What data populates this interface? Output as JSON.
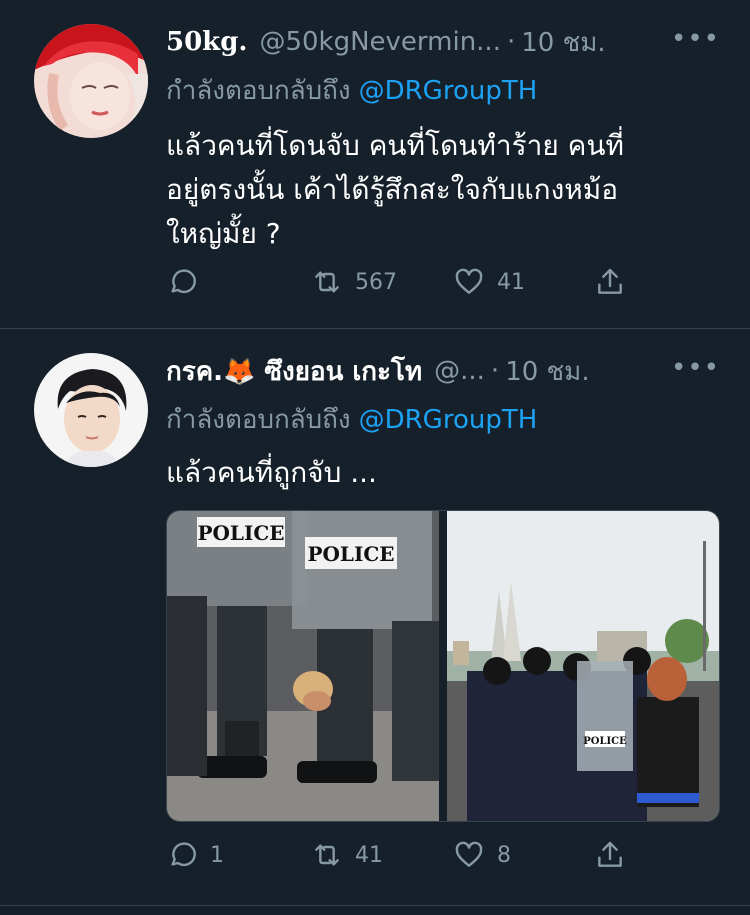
{
  "tweets": [
    {
      "display_name": "50kg.",
      "handle": "@50kgNevermin...",
      "time": "10 ชม.",
      "separator": "·",
      "more": "•••",
      "replying_prefix": "กำลังตอบกลับถึง",
      "replying_to": "@DRGroupTH",
      "text_lines": [
        "แล้วคนที่โดนจับ คนที่โดนทำร้าย คนที่",
        "อยู่ตรงนั้น เค้าได้รู้สึกสะใจกับแกงหม้อ",
        "ใหญ่มั้ย ?"
      ],
      "reply_count": "",
      "retweet_count": "567",
      "like_count": "41"
    },
    {
      "display_name": "กรค.🦊 ซึงยอน เกะโท",
      "handle": "@...",
      "time": "10 ชม.",
      "separator": "·",
      "more": "•••",
      "replying_prefix": "กำลังตอบกลับถึง",
      "replying_to": "@DRGroupTH",
      "text_lines": [
        "แล้วคนที่ถูกจับ ..."
      ],
      "reply_count": "1",
      "retweet_count": "41",
      "like_count": "8",
      "photo1_shield_text_a": "POLICE",
      "photo1_shield_text_b": "POLICE",
      "photo2_shield_text": "POLICE"
    }
  ],
  "colors": {
    "background": "#15202b",
    "secondary_text": "#8899a6",
    "link": "#1da1f2",
    "divider": "#38444d"
  }
}
